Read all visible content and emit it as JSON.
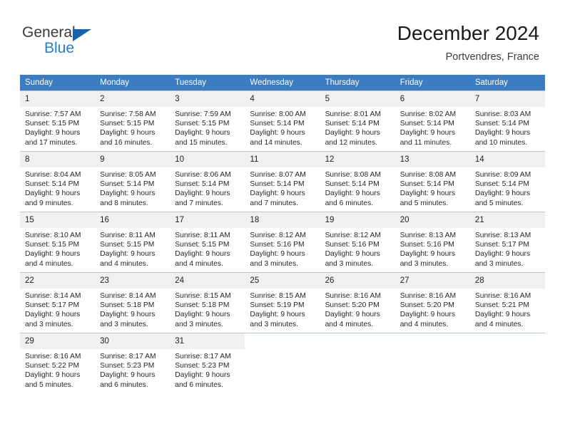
{
  "brand": {
    "name_top": "General",
    "name_bottom": "Blue",
    "accent_color": "#1f7fd0",
    "triangle_color": "#1563ad"
  },
  "header": {
    "title": "December 2024",
    "subtitle": "Portvendres, France"
  },
  "calendar": {
    "header_bg": "#3b7dc0",
    "daynum_bg": "#f0f0f0",
    "weekdays": [
      "Sunday",
      "Monday",
      "Tuesday",
      "Wednesday",
      "Thursday",
      "Friday",
      "Saturday"
    ],
    "weeks": [
      [
        {
          "day": "1",
          "sunrise": "Sunrise: 7:57 AM",
          "sunset": "Sunset: 5:15 PM",
          "daylight1": "Daylight: 9 hours",
          "daylight2": "and 17 minutes."
        },
        {
          "day": "2",
          "sunrise": "Sunrise: 7:58 AM",
          "sunset": "Sunset: 5:15 PM",
          "daylight1": "Daylight: 9 hours",
          "daylight2": "and 16 minutes."
        },
        {
          "day": "3",
          "sunrise": "Sunrise: 7:59 AM",
          "sunset": "Sunset: 5:15 PM",
          "daylight1": "Daylight: 9 hours",
          "daylight2": "and 15 minutes."
        },
        {
          "day": "4",
          "sunrise": "Sunrise: 8:00 AM",
          "sunset": "Sunset: 5:14 PM",
          "daylight1": "Daylight: 9 hours",
          "daylight2": "and 14 minutes."
        },
        {
          "day": "5",
          "sunrise": "Sunrise: 8:01 AM",
          "sunset": "Sunset: 5:14 PM",
          "daylight1": "Daylight: 9 hours",
          "daylight2": "and 12 minutes."
        },
        {
          "day": "6",
          "sunrise": "Sunrise: 8:02 AM",
          "sunset": "Sunset: 5:14 PM",
          "daylight1": "Daylight: 9 hours",
          "daylight2": "and 11 minutes."
        },
        {
          "day": "7",
          "sunrise": "Sunrise: 8:03 AM",
          "sunset": "Sunset: 5:14 PM",
          "daylight1": "Daylight: 9 hours",
          "daylight2": "and 10 minutes."
        }
      ],
      [
        {
          "day": "8",
          "sunrise": "Sunrise: 8:04 AM",
          "sunset": "Sunset: 5:14 PM",
          "daylight1": "Daylight: 9 hours",
          "daylight2": "and 9 minutes."
        },
        {
          "day": "9",
          "sunrise": "Sunrise: 8:05 AM",
          "sunset": "Sunset: 5:14 PM",
          "daylight1": "Daylight: 9 hours",
          "daylight2": "and 8 minutes."
        },
        {
          "day": "10",
          "sunrise": "Sunrise: 8:06 AM",
          "sunset": "Sunset: 5:14 PM",
          "daylight1": "Daylight: 9 hours",
          "daylight2": "and 7 minutes."
        },
        {
          "day": "11",
          "sunrise": "Sunrise: 8:07 AM",
          "sunset": "Sunset: 5:14 PM",
          "daylight1": "Daylight: 9 hours",
          "daylight2": "and 7 minutes."
        },
        {
          "day": "12",
          "sunrise": "Sunrise: 8:08 AM",
          "sunset": "Sunset: 5:14 PM",
          "daylight1": "Daylight: 9 hours",
          "daylight2": "and 6 minutes."
        },
        {
          "day": "13",
          "sunrise": "Sunrise: 8:08 AM",
          "sunset": "Sunset: 5:14 PM",
          "daylight1": "Daylight: 9 hours",
          "daylight2": "and 5 minutes."
        },
        {
          "day": "14",
          "sunrise": "Sunrise: 8:09 AM",
          "sunset": "Sunset: 5:14 PM",
          "daylight1": "Daylight: 9 hours",
          "daylight2": "and 5 minutes."
        }
      ],
      [
        {
          "day": "15",
          "sunrise": "Sunrise: 8:10 AM",
          "sunset": "Sunset: 5:15 PM",
          "daylight1": "Daylight: 9 hours",
          "daylight2": "and 4 minutes."
        },
        {
          "day": "16",
          "sunrise": "Sunrise: 8:11 AM",
          "sunset": "Sunset: 5:15 PM",
          "daylight1": "Daylight: 9 hours",
          "daylight2": "and 4 minutes."
        },
        {
          "day": "17",
          "sunrise": "Sunrise: 8:11 AM",
          "sunset": "Sunset: 5:15 PM",
          "daylight1": "Daylight: 9 hours",
          "daylight2": "and 4 minutes."
        },
        {
          "day": "18",
          "sunrise": "Sunrise: 8:12 AM",
          "sunset": "Sunset: 5:16 PM",
          "daylight1": "Daylight: 9 hours",
          "daylight2": "and 3 minutes."
        },
        {
          "day": "19",
          "sunrise": "Sunrise: 8:12 AM",
          "sunset": "Sunset: 5:16 PM",
          "daylight1": "Daylight: 9 hours",
          "daylight2": "and 3 minutes."
        },
        {
          "day": "20",
          "sunrise": "Sunrise: 8:13 AM",
          "sunset": "Sunset: 5:16 PM",
          "daylight1": "Daylight: 9 hours",
          "daylight2": "and 3 minutes."
        },
        {
          "day": "21",
          "sunrise": "Sunrise: 8:13 AM",
          "sunset": "Sunset: 5:17 PM",
          "daylight1": "Daylight: 9 hours",
          "daylight2": "and 3 minutes."
        }
      ],
      [
        {
          "day": "22",
          "sunrise": "Sunrise: 8:14 AM",
          "sunset": "Sunset: 5:17 PM",
          "daylight1": "Daylight: 9 hours",
          "daylight2": "and 3 minutes."
        },
        {
          "day": "23",
          "sunrise": "Sunrise: 8:14 AM",
          "sunset": "Sunset: 5:18 PM",
          "daylight1": "Daylight: 9 hours",
          "daylight2": "and 3 minutes."
        },
        {
          "day": "24",
          "sunrise": "Sunrise: 8:15 AM",
          "sunset": "Sunset: 5:18 PM",
          "daylight1": "Daylight: 9 hours",
          "daylight2": "and 3 minutes."
        },
        {
          "day": "25",
          "sunrise": "Sunrise: 8:15 AM",
          "sunset": "Sunset: 5:19 PM",
          "daylight1": "Daylight: 9 hours",
          "daylight2": "and 3 minutes."
        },
        {
          "day": "26",
          "sunrise": "Sunrise: 8:16 AM",
          "sunset": "Sunset: 5:20 PM",
          "daylight1": "Daylight: 9 hours",
          "daylight2": "and 4 minutes."
        },
        {
          "day": "27",
          "sunrise": "Sunrise: 8:16 AM",
          "sunset": "Sunset: 5:20 PM",
          "daylight1": "Daylight: 9 hours",
          "daylight2": "and 4 minutes."
        },
        {
          "day": "28",
          "sunrise": "Sunrise: 8:16 AM",
          "sunset": "Sunset: 5:21 PM",
          "daylight1": "Daylight: 9 hours",
          "daylight2": "and 4 minutes."
        }
      ],
      [
        {
          "day": "29",
          "sunrise": "Sunrise: 8:16 AM",
          "sunset": "Sunset: 5:22 PM",
          "daylight1": "Daylight: 9 hours",
          "daylight2": "and 5 minutes."
        },
        {
          "day": "30",
          "sunrise": "Sunrise: 8:17 AM",
          "sunset": "Sunset: 5:23 PM",
          "daylight1": "Daylight: 9 hours",
          "daylight2": "and 6 minutes."
        },
        {
          "day": "31",
          "sunrise": "Sunrise: 8:17 AM",
          "sunset": "Sunset: 5:23 PM",
          "daylight1": "Daylight: 9 hours",
          "daylight2": "and 6 minutes."
        },
        {
          "day": "",
          "sunrise": "",
          "sunset": "",
          "daylight1": "",
          "daylight2": ""
        },
        {
          "day": "",
          "sunrise": "",
          "sunset": "",
          "daylight1": "",
          "daylight2": ""
        },
        {
          "day": "",
          "sunrise": "",
          "sunset": "",
          "daylight1": "",
          "daylight2": ""
        },
        {
          "day": "",
          "sunrise": "",
          "sunset": "",
          "daylight1": "",
          "daylight2": ""
        }
      ]
    ]
  }
}
